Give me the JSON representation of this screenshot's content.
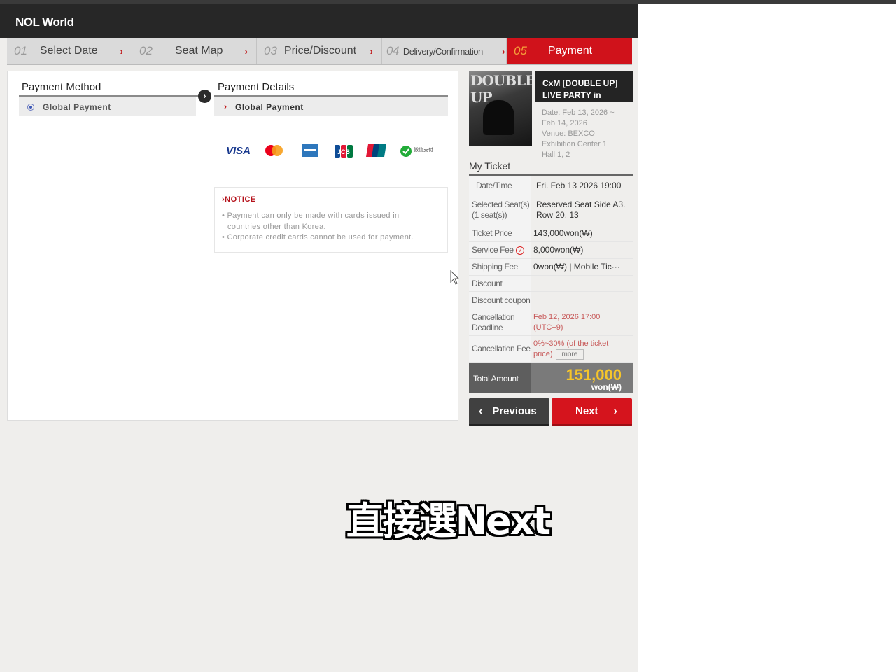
{
  "app": {
    "logo": "NOL World"
  },
  "steps": [
    {
      "num": "01",
      "label": "Select Date",
      "arrow": "›"
    },
    {
      "num": "02",
      "label": "Seat Map",
      "arrow": "›"
    },
    {
      "num": "03",
      "label": "Price/Discount",
      "arrow": "›"
    },
    {
      "num": "04",
      "label": "Delivery/Confirmation",
      "arrow": "›"
    },
    {
      "num": "05",
      "label": "Payment"
    }
  ],
  "payment_method": {
    "title": "Payment Method",
    "option": "Global Payment"
  },
  "payment_details": {
    "title": "Payment Details",
    "option": "Global Payment",
    "cards": [
      "VISA",
      "mastercard-icon",
      "amex-icon",
      "JCB",
      "UnionPay",
      "wechat-pay-icon"
    ],
    "wechat_label": "微信支付"
  },
  "notice": {
    "title": "NOTICE",
    "lines": [
      "Payment can only be made with cards issued in",
      "countries other than Korea.",
      "Corporate credit cards cannot be used for payment."
    ]
  },
  "event": {
    "poster_title": "DOUBLE UP",
    "title_line1": "CxM  [DOUBLE UP]",
    "title_line2": "LIVE PARTY in",
    "info": [
      "Date: Feb 13, 2026 ~",
      "Feb 14, 2026",
      "Venue: BEXCO",
      "Exhibition Center 1",
      "Hall 1, 2"
    ]
  },
  "my_ticket": {
    "title": "My Ticket",
    "rows": [
      {
        "label": "Date/Time",
        "value": "Fri. Feb 13 2026 19:00"
      },
      {
        "label": "Selected Seat(s)",
        "label2": "(1 seat(s))",
        "value": "Reserved Seat Side A3.",
        "value2": "Row 20. 13"
      },
      {
        "label": "Ticket Price",
        "value": "143,000won(₩)"
      },
      {
        "label": "Service Fee",
        "value": "8,000won(₩)"
      },
      {
        "label": "Shipping Fee",
        "value": "0won(₩) | Mobile Tic···"
      },
      {
        "label": "Discount",
        "value": ""
      },
      {
        "label": "Discount coupon",
        "value": ""
      },
      {
        "label": "Cancellation",
        "label2": "Deadline",
        "value": "Feb 12, 2026 17:00",
        "value2": "(UTC+9)"
      },
      {
        "label": "Cancellation Fee",
        "value": "0%~30% (of the ticket",
        "value2": "price)",
        "more": "more"
      }
    ],
    "total_label": "Total Amount",
    "total_amount": "151,000",
    "total_unit": "won(₩)"
  },
  "buttons": {
    "previous": "Previous",
    "next": "Next"
  },
  "overlay_caption": "直接選Next",
  "colors": {
    "brand_red": "#d0121b",
    "accent_yellow": "#f6c52a",
    "header_dark": "#272727"
  }
}
